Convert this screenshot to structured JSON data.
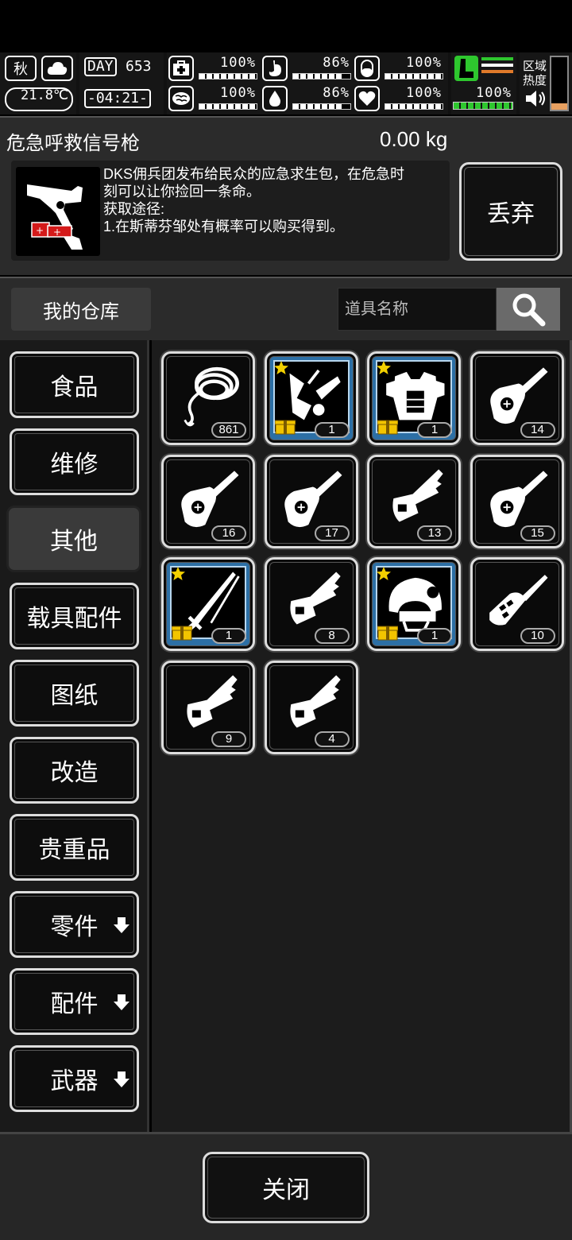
{
  "hud": {
    "season": "秋",
    "temperature": "21.8℃",
    "day_label": "DAY",
    "day_number": "653",
    "time": "-04:21-",
    "stats": {
      "health": "100%",
      "hunger": "86%",
      "stamina": "100%",
      "mental": "100%",
      "thirst": "86%",
      "heart": "100%",
      "vehicle": "100%"
    },
    "stat_levels": {
      "health": 1.0,
      "hunger": 0.86,
      "stamina": 1.0,
      "mental": 1.0,
      "thirst": 0.86,
      "heart": 1.0,
      "vehicle": 1.0
    },
    "zone_heat_label": "区域热度",
    "icons": [
      "leaf-icon",
      "cloud-icon",
      "medkit-icon",
      "brain-icon",
      "stomach-icon",
      "water-drop-icon",
      "pill-icon",
      "heart-icon",
      "vehicle-flag-icon",
      "speaker-icon"
    ]
  },
  "detail": {
    "name": "危急呼救信号枪",
    "weight": "0.00 kg",
    "description": "DKS佣兵团发布给民众的应急求生包，在危急时\n刻可以让你捡回一条命。\n获取途径:\n1.在斯蒂芬邹处有概率可以购买得到。",
    "discard_label": "丢弃",
    "thumb_icon": "flare-gun-icon"
  },
  "warehouse": {
    "title": "我的仓库",
    "search_placeholder": "道具名称",
    "search_icon": "magnifier-icon"
  },
  "categories": [
    {
      "label": "食品",
      "active": false,
      "has_arrow": false
    },
    {
      "label": "维修",
      "active": false,
      "has_arrow": false
    },
    {
      "label": "其他",
      "active": true,
      "has_arrow": false
    },
    {
      "label": "载具配件",
      "active": false,
      "has_arrow": false
    },
    {
      "label": "图纸",
      "active": false,
      "has_arrow": false
    },
    {
      "label": "改造",
      "active": false,
      "has_arrow": false
    },
    {
      "label": "贵重品",
      "active": false,
      "has_arrow": false
    },
    {
      "label": "零件",
      "active": false,
      "has_arrow": true
    },
    {
      "label": "配件",
      "active": false,
      "has_arrow": true
    },
    {
      "label": "武器",
      "active": false,
      "has_arrow": true
    }
  ],
  "items": [
    {
      "icon": "rope-icon",
      "count": "861",
      "rare": false
    },
    {
      "icon": "gun-parts-icon",
      "count": "1",
      "rare": true
    },
    {
      "icon": "armor-vest-icon",
      "count": "1",
      "rare": true
    },
    {
      "icon": "car-key-icon",
      "count": "14",
      "rare": false
    },
    {
      "icon": "car-key-icon",
      "count": "16",
      "rare": false
    },
    {
      "icon": "car-key-icon",
      "count": "17",
      "rare": false
    },
    {
      "icon": "key-icon",
      "count": "13",
      "rare": false
    },
    {
      "icon": "car-key-icon",
      "count": "15",
      "rare": false
    },
    {
      "icon": "katana-icon",
      "count": "1",
      "rare": true
    },
    {
      "icon": "key-icon",
      "count": "8",
      "rare": false
    },
    {
      "icon": "helmet-icon",
      "count": "1",
      "rare": true
    },
    {
      "icon": "flip-key-icon",
      "count": "10",
      "rare": false
    },
    {
      "icon": "key-icon",
      "count": "9",
      "rare": false
    },
    {
      "icon": "key-icon",
      "count": "4",
      "rare": false
    }
  ],
  "footer": {
    "close_label": "关闭"
  }
}
